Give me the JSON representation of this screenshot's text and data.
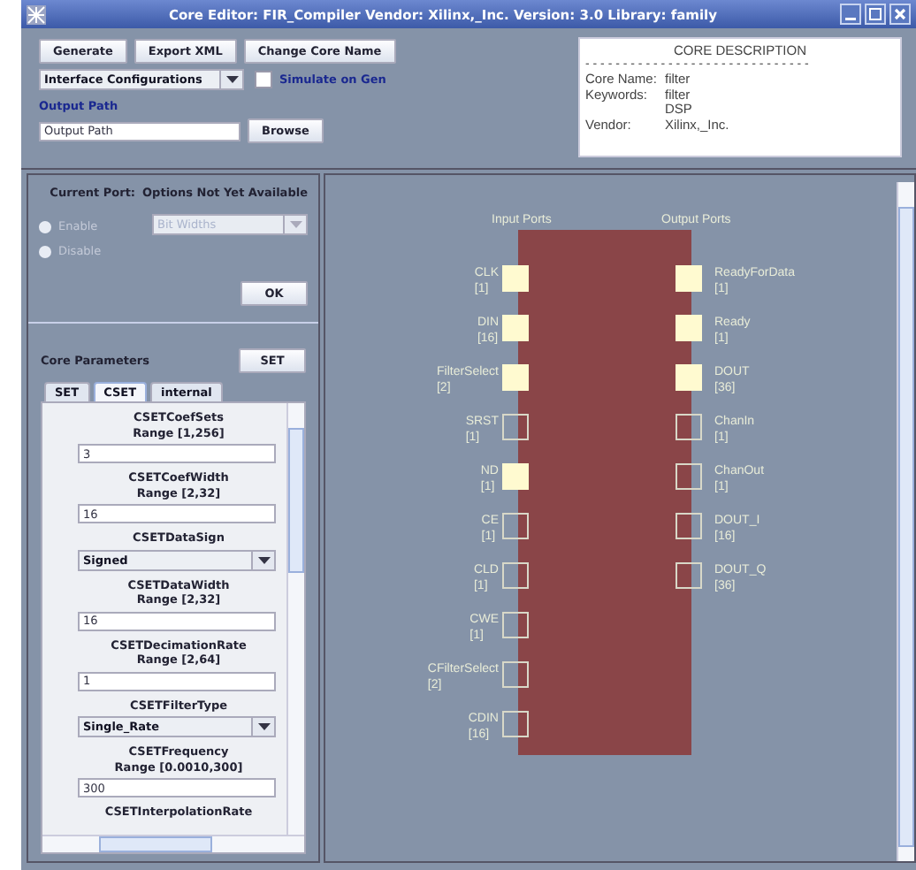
{
  "window": {
    "title": "Core Editor: FIR_Compiler Vendor: Xilinx,_Inc. Version: 3.0 Library: family"
  },
  "toolbar": {
    "buttons": [
      "Generate",
      "Export XML",
      "Change Core Name"
    ],
    "config_dropdown": "Interface Configurations",
    "simulate": {
      "label": "Simulate on Gen",
      "checked": false
    },
    "output_path_label": "Output Path",
    "output_path": {
      "value": "Output Path"
    },
    "browse": "Browse"
  },
  "core_description": {
    "title": "CORE DESCRIPTION",
    "divider": "- - - - - - - - - - - - - - - - - - - - - - - - - - - - - -",
    "rows": [
      {
        "key": "Core Name:",
        "value": "filter"
      },
      {
        "key": "Keywords:",
        "value": "filter"
      },
      {
        "key": "",
        "value": "DSP"
      },
      {
        "key": "Vendor:",
        "value": "Xilinx,_Inc."
      }
    ]
  },
  "current_port": {
    "label": "Current Port:",
    "status": "Options Not Yet Available",
    "radios": [
      {
        "label": "Enable",
        "selected": false,
        "disabled": true
      },
      {
        "label": "Disable",
        "selected": false,
        "disabled": true
      }
    ],
    "dropdown": {
      "value": "Bit Widths",
      "disabled": true
    },
    "ok": "OK"
  },
  "core_parameters": {
    "title": "Core Parameters",
    "set_button": "SET",
    "tabs": [
      {
        "label": "SET",
        "selected": false
      },
      {
        "label": "CSET",
        "selected": true
      },
      {
        "label": "internal",
        "selected": false
      }
    ],
    "params": [
      {
        "kind": "field",
        "name": "CSETCoefSets",
        "range": "Range [1,256]",
        "value": "3"
      },
      {
        "kind": "field",
        "name": "CSETCoefWidth",
        "range": "Range [2,32]",
        "value": "16"
      },
      {
        "kind": "select",
        "name": "CSETDataSign",
        "value": "Signed"
      },
      {
        "kind": "field",
        "name": "CSETDataWidth",
        "range": "Range [2,32]",
        "value": "16"
      },
      {
        "kind": "field",
        "name": "CSETDecimationRate",
        "range": "Range [2,64]",
        "value": "1"
      },
      {
        "kind": "select",
        "name": "CSETFilterType",
        "value": "Single_Rate"
      },
      {
        "kind": "field",
        "name": "CSETFrequency",
        "range": "Range [0.0010,300]",
        "value": "300"
      },
      {
        "kind": "heading",
        "name": "CSETInterpolationRate"
      }
    ]
  },
  "diagram": {
    "input_heading": "Input Ports",
    "output_heading": "Output Ports",
    "inputs": [
      {
        "name": "CLK",
        "width": "[1]",
        "active": true
      },
      {
        "name": "DIN",
        "width": "[16]",
        "active": true
      },
      {
        "name": "FilterSelect",
        "width": "[2]",
        "active": true
      },
      {
        "name": "SRST",
        "width": "[1]",
        "active": false
      },
      {
        "name": "ND",
        "width": "[1]",
        "active": true
      },
      {
        "name": "CE",
        "width": "[1]",
        "active": false
      },
      {
        "name": "CLD",
        "width": "[1]",
        "active": false
      },
      {
        "name": "CWE",
        "width": "[1]",
        "active": false
      },
      {
        "name": "CFilterSelect",
        "width": "[2]",
        "active": false
      },
      {
        "name": "CDIN",
        "width": "[16]",
        "active": false
      }
    ],
    "outputs": [
      {
        "name": "ReadyForData",
        "width": "[1]",
        "active": true
      },
      {
        "name": "Ready",
        "width": "[1]",
        "active": true
      },
      {
        "name": "DOUT",
        "width": "[36]",
        "active": true
      },
      {
        "name": "ChanIn",
        "width": "[1]",
        "active": false
      },
      {
        "name": "ChanOut",
        "width": "[1]",
        "active": false
      },
      {
        "name": "DOUT_I",
        "width": "[16]",
        "active": false
      },
      {
        "name": "DOUT_Q",
        "width": "[36]",
        "active": false
      }
    ]
  }
}
